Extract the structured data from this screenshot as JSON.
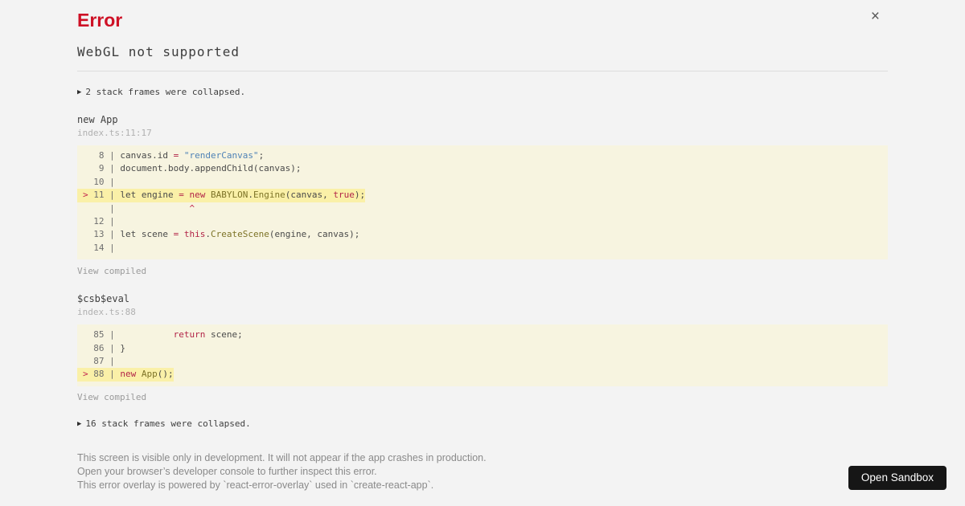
{
  "header": {
    "title": "Error",
    "message": "WebGL not supported",
    "close_glyph": "×"
  },
  "icons": {
    "collapse_arrow": "▶"
  },
  "stack": {
    "collapsed_top": "2 stack frames were collapsed.",
    "collapsed_bottom": "16 stack frames were collapsed.",
    "frames": [
      {
        "fn": "new App",
        "loc": "index.ts:11:17",
        "view_compiled": "View compiled",
        "lines": [
          {
            "hl": false,
            "seg": [
              [
                "g",
                "   8 | "
              ],
              [
                "d",
                "canvas.id "
              ],
              [
                "k",
                "="
              ],
              [
                "d",
                " "
              ],
              [
                "s",
                "\"renderCanvas\""
              ],
              [
                "d",
                ";"
              ]
            ]
          },
          {
            "hl": false,
            "seg": [
              [
                "g",
                "   9 | "
              ],
              [
                "d",
                "document.body.appendChild(canvas);"
              ]
            ]
          },
          {
            "hl": false,
            "seg": [
              [
                "g",
                "  10 | "
              ]
            ]
          },
          {
            "hl": true,
            "seg": [
              [
                "m",
                ">"
              ],
              [
                "g",
                " 11 | "
              ],
              [
                "d",
                "let engine "
              ],
              [
                "k",
                "="
              ],
              [
                "d",
                " "
              ],
              [
                "k",
                "new"
              ],
              [
                "d",
                " "
              ],
              [
                "c",
                "BABYLON"
              ],
              [
                "d",
                "."
              ],
              [
                "c",
                "Engine"
              ],
              [
                "d",
                "(canvas, "
              ],
              [
                "k",
                "true"
              ],
              [
                "d",
                ");"
              ]
            ]
          },
          {
            "hl": false,
            "seg": [
              [
                "g",
                "     |              "
              ],
              [
                "m",
                "^"
              ]
            ]
          },
          {
            "hl": false,
            "seg": [
              [
                "g",
                "  12 | "
              ]
            ]
          },
          {
            "hl": false,
            "seg": [
              [
                "g",
                "  13 | "
              ],
              [
                "d",
                "let scene "
              ],
              [
                "k",
                "="
              ],
              [
                "d",
                " "
              ],
              [
                "k",
                "this"
              ],
              [
                "d",
                "."
              ],
              [
                "c",
                "CreateScene"
              ],
              [
                "d",
                "(engine, canvas);"
              ]
            ]
          },
          {
            "hl": false,
            "seg": [
              [
                "g",
                "  14 | "
              ]
            ]
          }
        ]
      },
      {
        "fn": "$csb$eval",
        "loc": "index.ts:88",
        "view_compiled": "View compiled",
        "lines": [
          {
            "hl": false,
            "seg": [
              [
                "g",
                "  85 | "
              ],
              [
                "d",
                "          "
              ],
              [
                "k",
                "return"
              ],
              [
                "d",
                " scene;"
              ]
            ]
          },
          {
            "hl": false,
            "seg": [
              [
                "g",
                "  86 | "
              ],
              [
                "d",
                "}"
              ]
            ]
          },
          {
            "hl": false,
            "seg": [
              [
                "g",
                "  87 | "
              ]
            ]
          },
          {
            "hl": true,
            "seg": [
              [
                "m",
                ">"
              ],
              [
                "g",
                " 88 | "
              ],
              [
                "k",
                "new"
              ],
              [
                "d",
                " "
              ],
              [
                "c",
                "App"
              ],
              [
                "d",
                "();"
              ]
            ]
          }
        ]
      }
    ]
  },
  "footer": {
    "lines": [
      "This screen is visible only in development. It will not appear if the app crashes in production.",
      "Open your browser’s developer console to further inspect this error.",
      "This error overlay is powered by `react-error-overlay` used in `create-react-app`."
    ]
  },
  "sandbox": {
    "button_label": "Open Sandbox"
  },
  "colors": {
    "page_background": "#f3f3f3",
    "error_red": "#ce1126",
    "code_block_background": "#f7f4e0",
    "highlight_line_background": "#faf0a8",
    "keyword": "#b22448",
    "string": "#4f82b6",
    "identifier_capitalized": "#7d7327",
    "sandbox_button_background": "#161616"
  }
}
